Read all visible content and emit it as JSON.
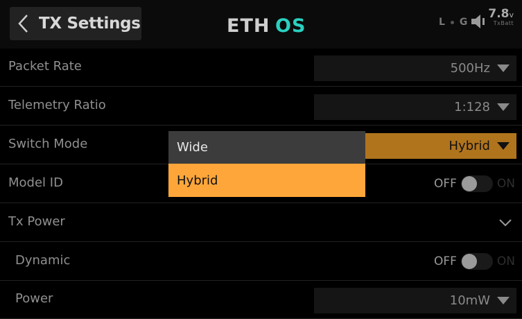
{
  "header": {
    "title": "TX Settings",
    "logo_text": "ETHOS",
    "status": {
      "indicator_l": "L",
      "indicator_g": "G",
      "battery_value": "7.8",
      "battery_unit": "v",
      "battery_label": "TxBatt"
    }
  },
  "rows": {
    "packet_rate": {
      "label": "Packet Rate",
      "value": "500Hz"
    },
    "telemetry_ratio": {
      "label": "Telemetry Ratio",
      "value": "1:128"
    },
    "switch_mode": {
      "label": "Switch Mode",
      "value": "Hybrid"
    },
    "model_id": {
      "label": "Model ID",
      "off": "OFF",
      "on": "ON",
      "state": "off"
    },
    "tx_power": {
      "label": "Tx Power"
    },
    "dynamic": {
      "label": "Dynamic",
      "off": "OFF",
      "on": "ON",
      "state": "off"
    },
    "power": {
      "label": "Power",
      "value": "10mW"
    }
  },
  "dropdown": {
    "options": [
      "Wide",
      "Hybrid"
    ],
    "selected": "Hybrid"
  },
  "colors": {
    "accent": "#ffa63a",
    "active_field": "#b0741d",
    "background": "#000000"
  }
}
